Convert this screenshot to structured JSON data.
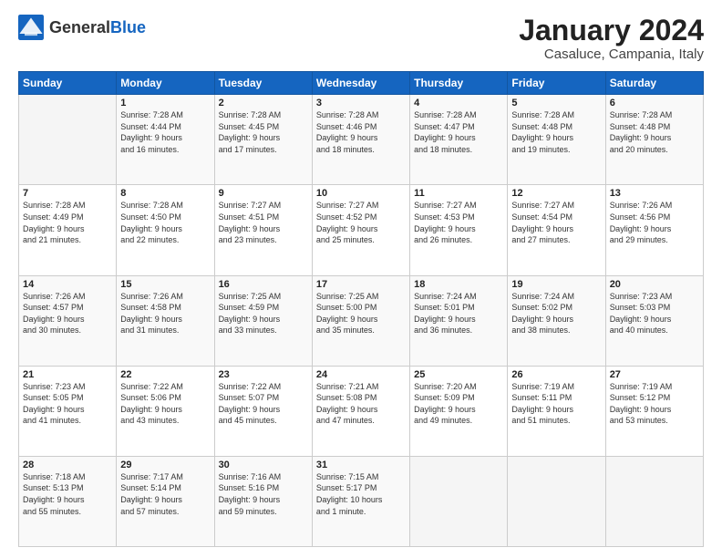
{
  "logo": {
    "general": "General",
    "blue": "Blue"
  },
  "title": "January 2024",
  "subtitle": "Casaluce, Campania, Italy",
  "header_days": [
    "Sunday",
    "Monday",
    "Tuesday",
    "Wednesday",
    "Thursday",
    "Friday",
    "Saturday"
  ],
  "weeks": [
    [
      {
        "day": "",
        "info": ""
      },
      {
        "day": "1",
        "info": "Sunrise: 7:28 AM\nSunset: 4:44 PM\nDaylight: 9 hours\nand 16 minutes."
      },
      {
        "day": "2",
        "info": "Sunrise: 7:28 AM\nSunset: 4:45 PM\nDaylight: 9 hours\nand 17 minutes."
      },
      {
        "day": "3",
        "info": "Sunrise: 7:28 AM\nSunset: 4:46 PM\nDaylight: 9 hours\nand 18 minutes."
      },
      {
        "day": "4",
        "info": "Sunrise: 7:28 AM\nSunset: 4:47 PM\nDaylight: 9 hours\nand 18 minutes."
      },
      {
        "day": "5",
        "info": "Sunrise: 7:28 AM\nSunset: 4:48 PM\nDaylight: 9 hours\nand 19 minutes."
      },
      {
        "day": "6",
        "info": "Sunrise: 7:28 AM\nSunset: 4:48 PM\nDaylight: 9 hours\nand 20 minutes."
      }
    ],
    [
      {
        "day": "7",
        "info": "Sunrise: 7:28 AM\nSunset: 4:49 PM\nDaylight: 9 hours\nand 21 minutes."
      },
      {
        "day": "8",
        "info": "Sunrise: 7:28 AM\nSunset: 4:50 PM\nDaylight: 9 hours\nand 22 minutes."
      },
      {
        "day": "9",
        "info": "Sunrise: 7:27 AM\nSunset: 4:51 PM\nDaylight: 9 hours\nand 23 minutes."
      },
      {
        "day": "10",
        "info": "Sunrise: 7:27 AM\nSunset: 4:52 PM\nDaylight: 9 hours\nand 25 minutes."
      },
      {
        "day": "11",
        "info": "Sunrise: 7:27 AM\nSunset: 4:53 PM\nDaylight: 9 hours\nand 26 minutes."
      },
      {
        "day": "12",
        "info": "Sunrise: 7:27 AM\nSunset: 4:54 PM\nDaylight: 9 hours\nand 27 minutes."
      },
      {
        "day": "13",
        "info": "Sunrise: 7:26 AM\nSunset: 4:56 PM\nDaylight: 9 hours\nand 29 minutes."
      }
    ],
    [
      {
        "day": "14",
        "info": "Sunrise: 7:26 AM\nSunset: 4:57 PM\nDaylight: 9 hours\nand 30 minutes."
      },
      {
        "day": "15",
        "info": "Sunrise: 7:26 AM\nSunset: 4:58 PM\nDaylight: 9 hours\nand 31 minutes."
      },
      {
        "day": "16",
        "info": "Sunrise: 7:25 AM\nSunset: 4:59 PM\nDaylight: 9 hours\nand 33 minutes."
      },
      {
        "day": "17",
        "info": "Sunrise: 7:25 AM\nSunset: 5:00 PM\nDaylight: 9 hours\nand 35 minutes."
      },
      {
        "day": "18",
        "info": "Sunrise: 7:24 AM\nSunset: 5:01 PM\nDaylight: 9 hours\nand 36 minutes."
      },
      {
        "day": "19",
        "info": "Sunrise: 7:24 AM\nSunset: 5:02 PM\nDaylight: 9 hours\nand 38 minutes."
      },
      {
        "day": "20",
        "info": "Sunrise: 7:23 AM\nSunset: 5:03 PM\nDaylight: 9 hours\nand 40 minutes."
      }
    ],
    [
      {
        "day": "21",
        "info": "Sunrise: 7:23 AM\nSunset: 5:05 PM\nDaylight: 9 hours\nand 41 minutes."
      },
      {
        "day": "22",
        "info": "Sunrise: 7:22 AM\nSunset: 5:06 PM\nDaylight: 9 hours\nand 43 minutes."
      },
      {
        "day": "23",
        "info": "Sunrise: 7:22 AM\nSunset: 5:07 PM\nDaylight: 9 hours\nand 45 minutes."
      },
      {
        "day": "24",
        "info": "Sunrise: 7:21 AM\nSunset: 5:08 PM\nDaylight: 9 hours\nand 47 minutes."
      },
      {
        "day": "25",
        "info": "Sunrise: 7:20 AM\nSunset: 5:09 PM\nDaylight: 9 hours\nand 49 minutes."
      },
      {
        "day": "26",
        "info": "Sunrise: 7:19 AM\nSunset: 5:11 PM\nDaylight: 9 hours\nand 51 minutes."
      },
      {
        "day": "27",
        "info": "Sunrise: 7:19 AM\nSunset: 5:12 PM\nDaylight: 9 hours\nand 53 minutes."
      }
    ],
    [
      {
        "day": "28",
        "info": "Sunrise: 7:18 AM\nSunset: 5:13 PM\nDaylight: 9 hours\nand 55 minutes."
      },
      {
        "day": "29",
        "info": "Sunrise: 7:17 AM\nSunset: 5:14 PM\nDaylight: 9 hours\nand 57 minutes."
      },
      {
        "day": "30",
        "info": "Sunrise: 7:16 AM\nSunset: 5:16 PM\nDaylight: 9 hours\nand 59 minutes."
      },
      {
        "day": "31",
        "info": "Sunrise: 7:15 AM\nSunset: 5:17 PM\nDaylight: 10 hours\nand 1 minute."
      },
      {
        "day": "",
        "info": ""
      },
      {
        "day": "",
        "info": ""
      },
      {
        "day": "",
        "info": ""
      }
    ]
  ]
}
